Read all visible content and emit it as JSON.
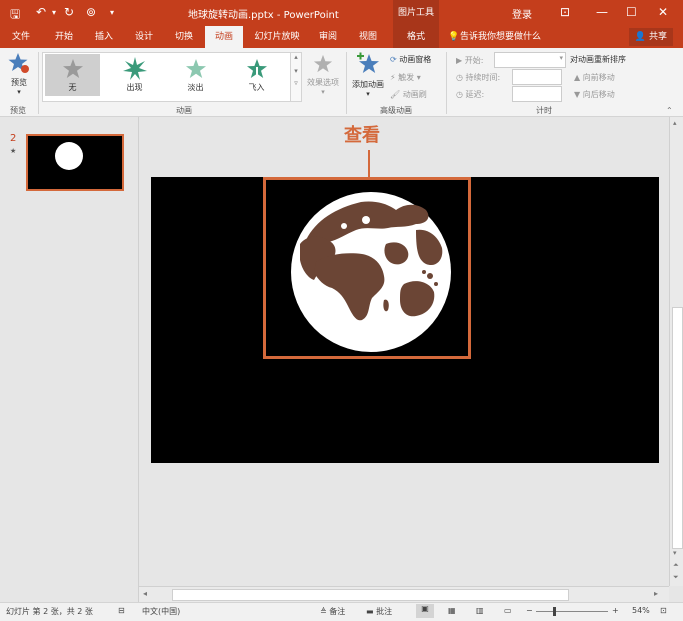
{
  "titlebar": {
    "doc_title": "地球旋转动画.pptx  -  PowerPoint",
    "context_tool": "图片工具",
    "login": "登录"
  },
  "tabs": [
    "文件",
    "开始",
    "插入",
    "设计",
    "切换",
    "动画",
    "幻灯片放映",
    "审阅",
    "视图",
    "格式"
  ],
  "tell_me": "告诉我你想要做什么",
  "share": "共享",
  "ribbon": {
    "preview": {
      "label": "预览",
      "group": "预览"
    },
    "animation_gallery": [
      {
        "label": "无",
        "color": "#9a9a9a"
      },
      {
        "label": "出现",
        "color": "#3a9a7a"
      },
      {
        "label": "淡出",
        "color": "#6ab89a"
      },
      {
        "label": "飞入",
        "color": "#3a9a7a"
      }
    ],
    "effect_options": "效果选项",
    "animation_group": "动画",
    "add_animation": "添加动画",
    "animation_pane": "动画窗格",
    "trigger": "触发",
    "animation_painter": "动画刷",
    "advanced_group": "高级动画",
    "start_label": "开始:",
    "duration_label": "持续时间:",
    "delay_label": "延迟:",
    "reorder_title": "对动画重新排序",
    "move_earlier": "向前移动",
    "move_later": "向后移动",
    "timing_group": "计时"
  },
  "thumb": {
    "number": "2",
    "star": "★"
  },
  "callout": {
    "label": "查看",
    "color": "#d4693b"
  },
  "status": {
    "slide_info": "幻灯片 第 2 张，共 2 张",
    "language": "中文(中国)",
    "notes": "备注",
    "comments": "批注",
    "zoom": "54%"
  }
}
